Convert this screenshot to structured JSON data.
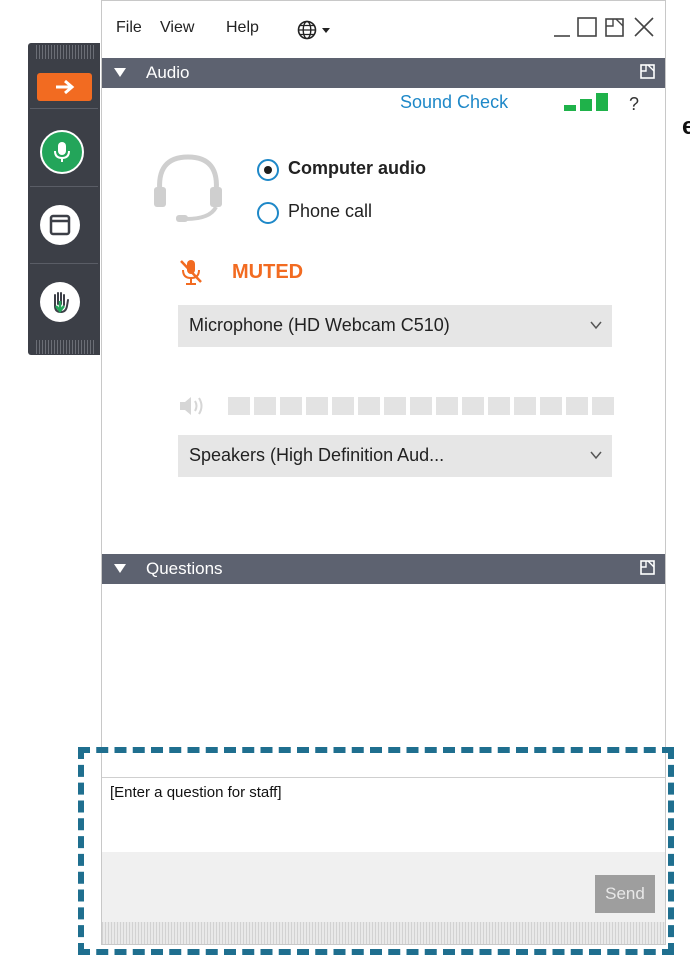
{
  "menu": {
    "file": "File",
    "view": "View",
    "help": "Help"
  },
  "audio_panel": {
    "header": "Audio",
    "sound_check": "Sound Check",
    "help": "?",
    "options": [
      {
        "label": "Computer audio",
        "selected": true
      },
      {
        "label": "Phone call",
        "selected": false
      }
    ],
    "mic_status": "MUTED",
    "microphone": "Microphone (HD Webcam C510)",
    "speakers": "Speakers (High Definition Aud..."
  },
  "questions_panel": {
    "header": "Questions",
    "input_placeholder": "[Enter a question for staff]",
    "send": "Send"
  },
  "margin_letter": "e",
  "colors": {
    "accent_orange": "#f26b21",
    "accent_blue": "#1e88c8",
    "signal_green": "#1fb24a",
    "panel_header": "#5d6270"
  },
  "icons": [
    "arrow-right-icon",
    "microphone-icon",
    "window-icon",
    "raise-hand-icon",
    "globe-icon",
    "headset-icon",
    "muted-mic-icon",
    "speaker-icon",
    "popout-icon"
  ]
}
